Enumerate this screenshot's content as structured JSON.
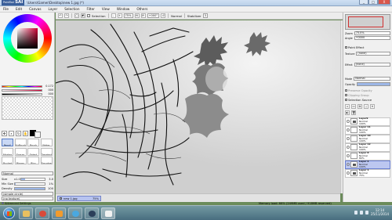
{
  "window": {
    "app_logo_top": "PaintTool",
    "app_logo": "SAI",
    "title": "\\Users\\Gamer\\Desktop\\new 1.jpg (*)",
    "controls": [
      "_",
      "□",
      "X"
    ]
  },
  "menu": [
    "File",
    "Edit",
    "Canvas",
    "Layer",
    "Selection",
    "Filter",
    "View",
    "Window",
    "Others"
  ],
  "toolbar": {
    "selection_label": "Selection",
    "zoom": "75%",
    "rotation": "+000°",
    "normal_label": "Normal",
    "stabilizer_label": "Stabilizer",
    "stabilizer_value": "3"
  },
  "color_panel": {
    "sliders": [
      {
        "label": "H",
        "value": "0.172"
      },
      {
        "label": "S",
        "value": "000"
      },
      {
        "label": "V",
        "value": "000"
      }
    ]
  },
  "tools": {
    "brushes": [
      "Pencil",
      "AirBrush",
      "Brush",
      "Water",
      "Marker",
      "Eraser",
      "Select",
      "Deselect",
      "Bucket",
      "Binary",
      "Blur",
      "Smudge"
    ],
    "active_brush": "Pencil"
  },
  "brush_props": {
    "blend_mode": "Normal",
    "size_label": "Size",
    "size_multiplier": "x1.0",
    "size_value": "3.0",
    "size_level": 0.15,
    "min_size_label": "Min Size",
    "min_size_value": "1%",
    "min_size_level": 0.02,
    "density_label": "Density",
    "density_value": "100",
    "density_level": 1.0,
    "shape": "(simple circle)",
    "texture": "(no texture)",
    "advanced_label": "Advanced Settings"
  },
  "navigator": {
    "zoom_label": "Zoom",
    "zoom_value": "75.0%",
    "angle_label": "Angle",
    "angle_value": "+0000"
  },
  "layer_panel": {
    "paint_effect": "Paint Effect",
    "texture_label": "Texture",
    "texture_value": "(none)",
    "effect_label": "Effect",
    "effect_value": "(none)",
    "mode_label": "Mode",
    "mode_value": "Normal",
    "opacity_label": "Opacity",
    "preserve_opacity": "Preserve Opacity",
    "clipping_group": "Clipping Group",
    "selection_source": "Selection Source",
    "layers": [
      {
        "name": "Layer9",
        "mode": "Normal",
        "opacity": "100%",
        "dark": true,
        "selected": false
      },
      {
        "name": "Layer 11",
        "mode": "Normal",
        "opacity": "100%",
        "dark": false,
        "selected": false
      },
      {
        "name": "Layer 10",
        "mode": "Normal",
        "opacity": "100%",
        "dark": false,
        "selected": false
      },
      {
        "name": "Layer 12",
        "mode": "Normal",
        "opacity": "100%",
        "dark": false,
        "selected": false
      },
      {
        "name": "Layer 8",
        "mode": "Normal",
        "opacity": "80%",
        "dark": false,
        "selected": false
      },
      {
        "name": "Layer 4",
        "mode": "Normal",
        "opacity": "100%",
        "dark": true,
        "selected": true
      },
      {
        "name": "Layer 1",
        "mode": "Normal",
        "opacity": "75%",
        "dark": true,
        "selected": false
      }
    ]
  },
  "doc_tab": {
    "name": "new 1.jpg",
    "zoom": "75%"
  },
  "status": {
    "memory": "Memory load: 66% (249MB used / 918MB reserved)"
  },
  "taskbar": {
    "time": "12:14",
    "date": "25/11/2014"
  }
}
